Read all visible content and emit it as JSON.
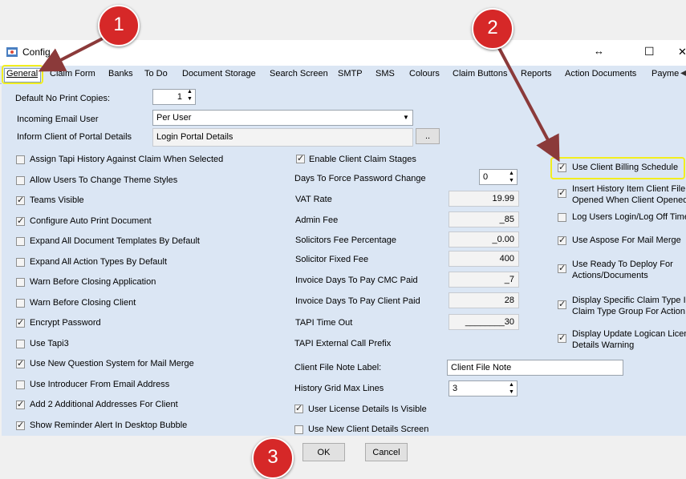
{
  "window": {
    "title": "Config",
    "ctrl_resize": "↔",
    "ctrl_max": "☐",
    "ctrl_close": "✕"
  },
  "tabs": [
    "General",
    "Claim Form",
    "Banks",
    "To Do",
    "Document Storage",
    "Search Screen",
    "SMTP",
    "SMS",
    "Colours",
    "Claim Buttons",
    "Reports",
    "Action Documents",
    "Payme"
  ],
  "top": {
    "no_print_label": "Default No Print Copies:",
    "no_print_value": "1",
    "email_user_label": "Incoming Email User",
    "email_user_value": "Per User",
    "portal_label": "Inform Client of Portal Details",
    "portal_value": "Login Portal Details",
    "portal_btn": ".."
  },
  "left_checks": [
    {
      "label": "Assign Tapi History Against Claim When Selected",
      "checked": false
    },
    {
      "label": "Allow Users To Change Theme Styles",
      "checked": false
    },
    {
      "label": "Teams Visible",
      "checked": true
    },
    {
      "label": "Configure Auto Print Document",
      "checked": true
    },
    {
      "label": "Expand All Document Templates By Default",
      "checked": false
    },
    {
      "label": "Expand All Action Types By Default",
      "checked": false
    },
    {
      "label": "Warn Before Closing Application",
      "checked": false
    },
    {
      "label": "Warn Before Closing Client",
      "checked": false
    },
    {
      "label": "Encrypt Password",
      "checked": true
    },
    {
      "label": "Use Tapi3",
      "checked": false
    },
    {
      "label": "Use New Question System for Mail Merge",
      "checked": true
    },
    {
      "label": "Use Introducer From Email Address",
      "checked": false
    },
    {
      "label": "Add 2 Additional Addresses For Client",
      "checked": true
    },
    {
      "label": "Show Reminder Alert In Desktop Bubble",
      "checked": true
    }
  ],
  "mid": {
    "enable_stages": {
      "label": "Enable Client Claim Stages",
      "checked": true
    },
    "force_pw_label": "Days To Force Password Change",
    "force_pw_value": "0",
    "fields": [
      {
        "label": "VAT Rate",
        "value": "19.99"
      },
      {
        "label": "Admin Fee",
        "value": "_85"
      },
      {
        "label": "Solicitors Fee Percentage",
        "value": "_0.00"
      },
      {
        "label": "Solicitor Fixed Fee",
        "value": "400"
      },
      {
        "label": "Invoice Days To Pay CMC Paid",
        "value": "_7"
      },
      {
        "label": "Invoice Days To Pay Client Paid",
        "value": "28"
      },
      {
        "label": "TAPI Time Out",
        "value": "________30"
      }
    ],
    "tapi_prefix_label": "TAPI External Call Prefix",
    "file_note_label": "Client File Note Label:",
    "file_note_value": "Client File Note",
    "grid_lines_label": "History Grid Max Lines",
    "grid_lines_value": "3",
    "license_visible": {
      "label": "User License Details Is Visible",
      "checked": true
    },
    "new_client_screen": {
      "label": "Use New Client Details Screen",
      "checked": false
    }
  },
  "right_checks": [
    {
      "line1": "Use Client Billing Schedule",
      "line2": "",
      "checked": true
    },
    {
      "line1": "Insert History Item Client File",
      "line2": "Opened When Client Opened",
      "checked": true
    },
    {
      "line1": "Log Users Login/Log Off Time",
      "line2": "",
      "checked": false
    },
    {
      "line1": "Use Aspose For Mail Merge",
      "line2": "",
      "checked": true
    },
    {
      "line1": "Use Ready To Deploy For",
      "line2": "Actions/Documents",
      "checked": true
    },
    {
      "line1": "Display Specific Claim Type In",
      "line2": "Claim Type Group For Action",
      "checked": true
    },
    {
      "line1": "Display Update Logican Licen",
      "line2": "Details Warning",
      "checked": true
    }
  ],
  "buttons": {
    "ok": "OK",
    "cancel": "Cancel"
  },
  "badges": [
    "1",
    "2",
    "3"
  ],
  "colors": {
    "badge": "#d62828",
    "highlight": "#f2ee1e",
    "arrow": "#8b3a3a",
    "panel": "#dbe6f4"
  }
}
